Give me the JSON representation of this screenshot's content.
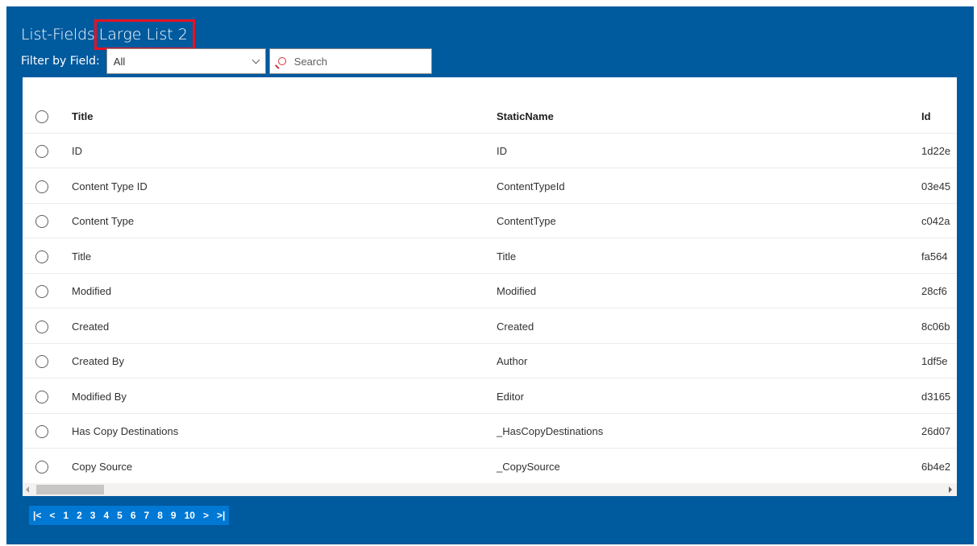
{
  "header": {
    "title_prefix": "List-Fields",
    "list_name": "Large List 2"
  },
  "filter": {
    "label": "Filter by Field:",
    "selected": "All",
    "search_placeholder": "Search"
  },
  "table": {
    "columns": [
      "Title",
      "StaticName",
      "Id"
    ],
    "rows": [
      {
        "title": "ID",
        "static": "ID",
        "id": "1d22e"
      },
      {
        "title": "Content Type ID",
        "static": "ContentTypeId",
        "id": "03e45"
      },
      {
        "title": "Content Type",
        "static": "ContentType",
        "id": "c042a"
      },
      {
        "title": "Title",
        "static": "Title",
        "id": "fa564"
      },
      {
        "title": "Modified",
        "static": "Modified",
        "id": "28cf6"
      },
      {
        "title": "Created",
        "static": "Created",
        "id": "8c06b"
      },
      {
        "title": "Created By",
        "static": "Author",
        "id": "1df5e"
      },
      {
        "title": "Modified By",
        "static": "Editor",
        "id": "d3165"
      },
      {
        "title": "Has Copy Destinations",
        "static": "_HasCopyDestinations",
        "id": "26d07"
      },
      {
        "title": "Copy Source",
        "static": "_CopySource",
        "id": "6b4e2"
      }
    ]
  },
  "pager": {
    "first": "|<",
    "prev": "<",
    "pages": [
      "1",
      "2",
      "3",
      "4",
      "5",
      "6",
      "7",
      "8",
      "9",
      "10"
    ],
    "next": ">",
    "last": ">|"
  }
}
